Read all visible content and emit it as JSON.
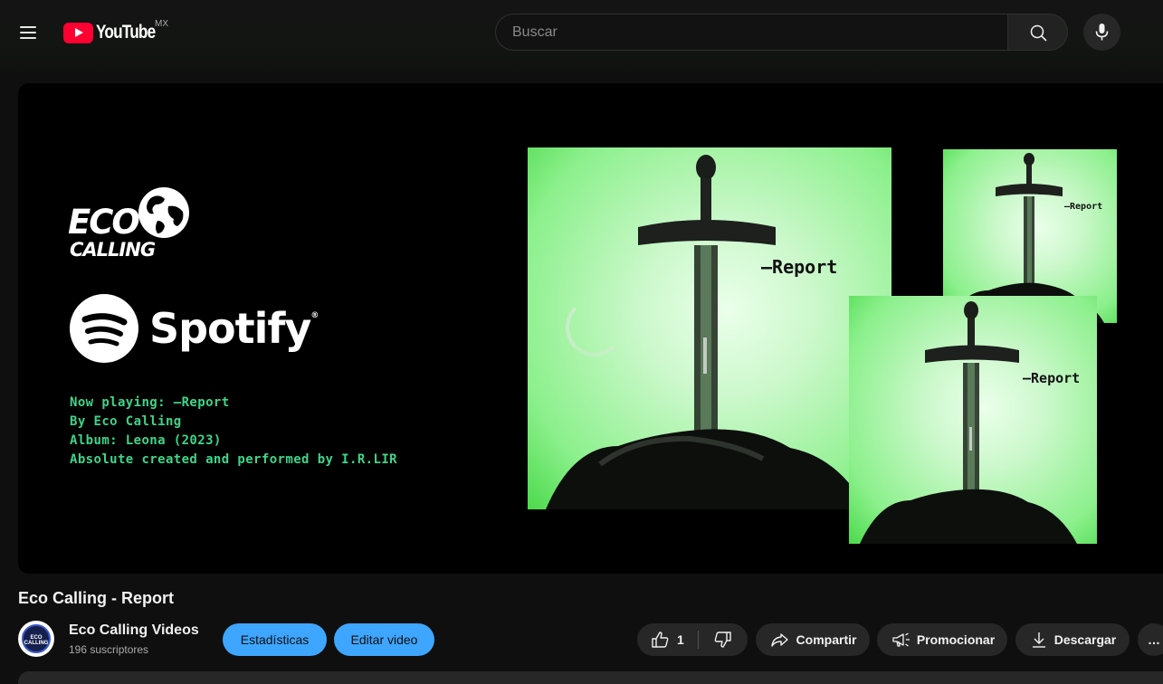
{
  "header": {
    "logo_text": "YouTube",
    "country_code": "MX",
    "search_placeholder": "Buscar",
    "icons": [
      "hamburger-menu-icon",
      "youtube-logo-icon",
      "search-icon",
      "microphone-icon"
    ]
  },
  "video": {
    "brand_logo_text": [
      "ECO",
      "CALLING"
    ],
    "platform_text": "Spotify",
    "now_playing_lines": [
      "Now playing: —Report",
      "By Eco Calling",
      "Album: Leona (2023)",
      "Absolute created and performed by I.R.LIR"
    ],
    "artwork_label": "—Report",
    "loading": true
  },
  "info": {
    "title": "Eco Calling - Report",
    "channel_name": "Eco Calling Videos",
    "channel_avatar_text": "ECO CALLING",
    "subscribers": "196 suscriptores",
    "stats_button": "Estadísticas",
    "edit_button": "Editar video",
    "like_count": "1",
    "share_button": "Compartir",
    "promote_button": "Promocionar",
    "download_button": "Descargar",
    "more_button": "…"
  },
  "colors": {
    "background": "#0f0f0f",
    "accent_blue": "#3ea6ff",
    "youtube_red": "#ff0033",
    "now_playing_green": "#3fd48a",
    "artwork_green": "#8cf08c"
  }
}
